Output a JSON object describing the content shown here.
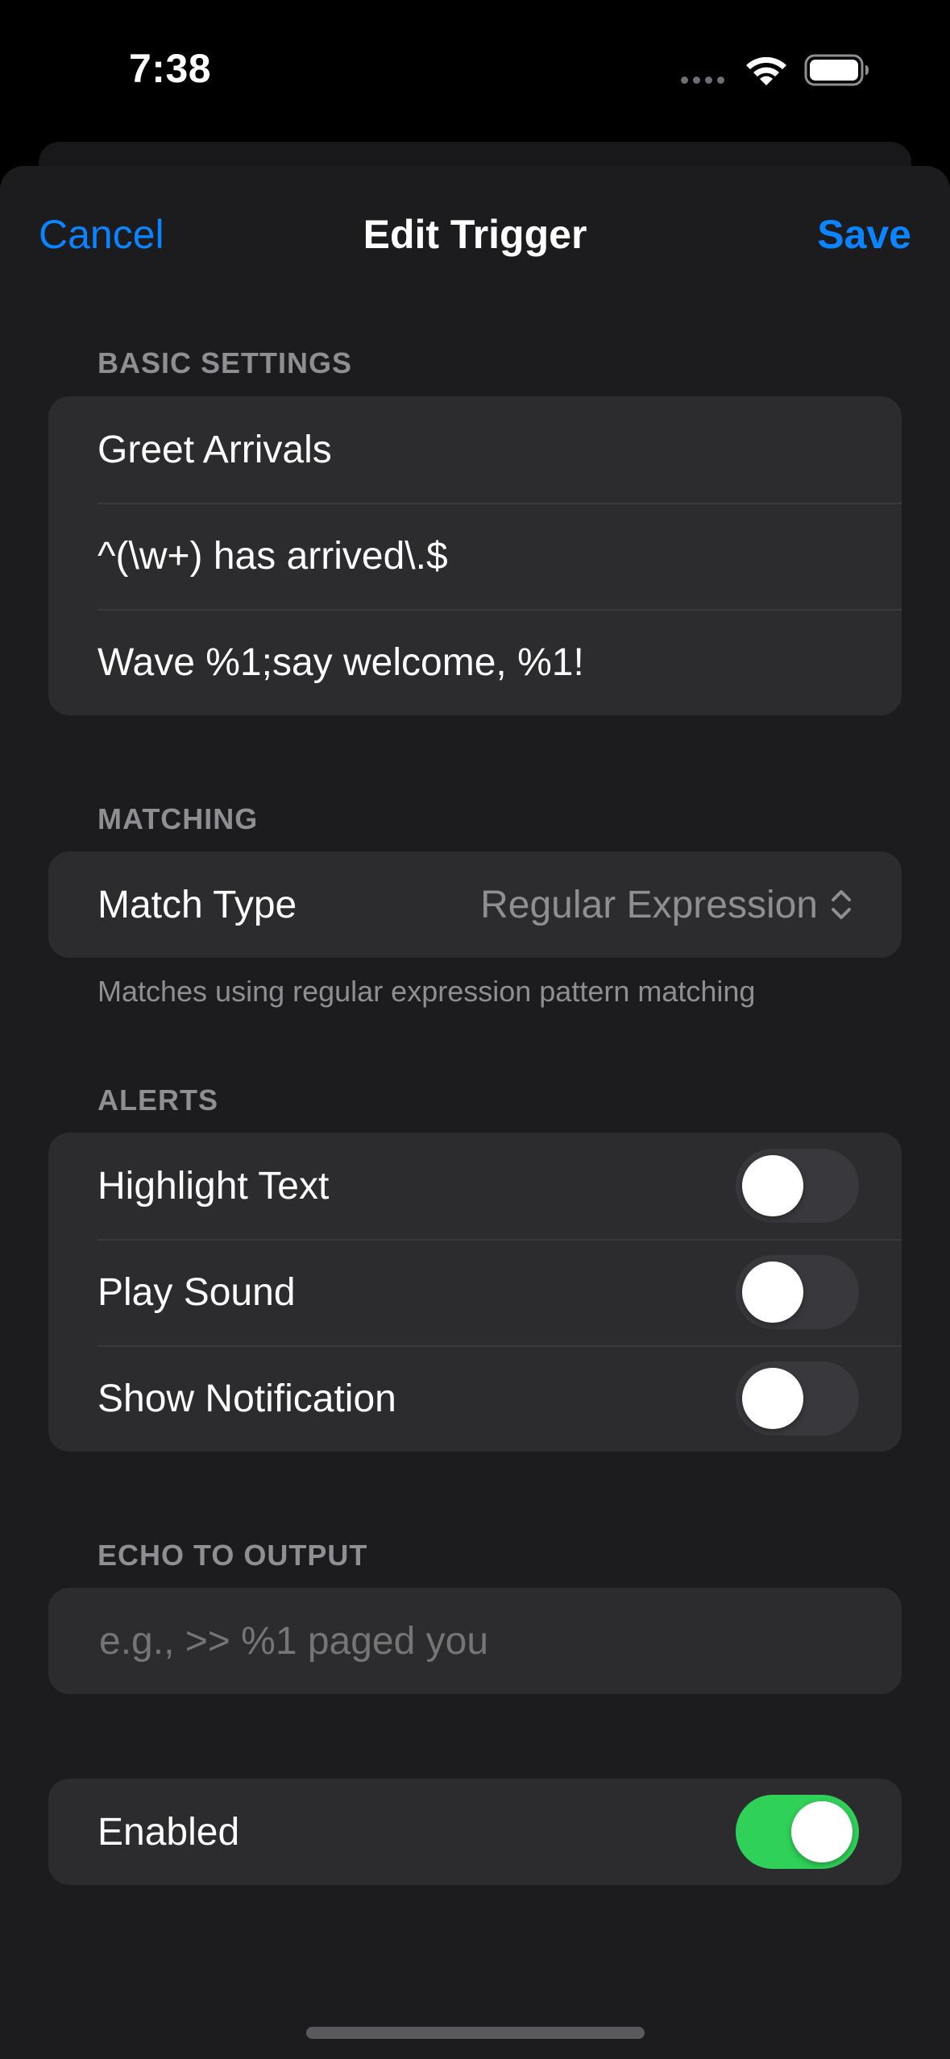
{
  "status": {
    "time": "7:38"
  },
  "nav": {
    "cancel": "Cancel",
    "title": "Edit Trigger",
    "save": "Save"
  },
  "basic": {
    "header": "BASIC SETTINGS",
    "name": "Greet Arrivals",
    "pattern": "^(\\w+) has arrived\\.$",
    "command": "Wave %1;say welcome, %1!"
  },
  "matching": {
    "header": "MATCHING",
    "label": "Match Type",
    "value": "Regular Expression",
    "footer": "Matches using regular expression pattern matching"
  },
  "alerts": {
    "header": "ALERTS",
    "items": [
      {
        "label": "Highlight Text",
        "on": false
      },
      {
        "label": "Play Sound",
        "on": false
      },
      {
        "label": "Show Notification",
        "on": false
      }
    ]
  },
  "echo": {
    "header": "ECHO TO OUTPUT",
    "placeholder": "e.g., >> %1 paged you"
  },
  "enabled": {
    "label": "Enabled",
    "on": true
  },
  "colors": {
    "accent": "#0a84ff",
    "toggle_on": "#30d158",
    "background": "#1c1c1e",
    "cell": "#2c2c2e"
  }
}
